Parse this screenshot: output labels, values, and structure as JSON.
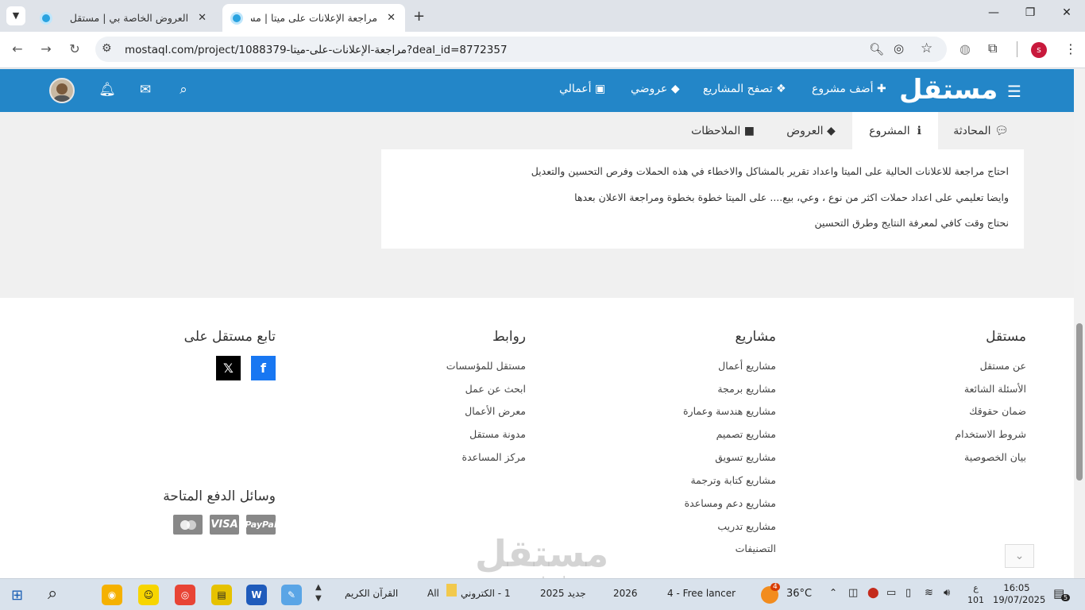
{
  "browser": {
    "tabs": [
      {
        "title": "العروض الخاصة بي | مستقل",
        "active": false
      },
      {
        "title": "مراجعة الإعلانات على ميتا | مستقل",
        "active": true
      }
    ],
    "new_tab": "+",
    "url": "mostaql.com/project/1088379-مراجعة-الإعلانات-على-ميتا?deal_id=8772357",
    "profile_initial": "s"
  },
  "site": {
    "logo": "مستقل",
    "nav": {
      "add_project": "أضف مشروع",
      "browse_projects": "تصفح المشاريع",
      "my_bids": "عروضي",
      "my_works": "أعمالي"
    },
    "project_tabs": {
      "conversation": "المحادثة",
      "project": "المشروع",
      "bids": "العروض",
      "notes": "الملاحظات"
    },
    "description": [
      "احتاج مراجعة للاعلانات الحالية على الميتا واعداد تقرير بالمشاكل والاخطاء في هذه الحملات وفرص التحسين والتعديل",
      "وايضا تعليمي على اعداد حملات اكثر من نوع ، وعي، بيع.... على الميتا خطوة بخطوة ومراجعة الاعلان بعدها",
      "نحتاج وقت كافي لمعرفة النتايج وطرق التحسين"
    ]
  },
  "footer": {
    "mostaql": {
      "heading": "مستقل",
      "links": [
        "عن مستقل",
        "الأسئلة الشائعة",
        "ضمان حقوقك",
        "شروط الاستخدام",
        "بيان الخصوصية"
      ]
    },
    "projects": {
      "heading": "مشاريع",
      "links": [
        "مشاريع أعمال",
        "مشاريع برمجة",
        "مشاريع هندسة وعمارة",
        "مشاريع تصميم",
        "مشاريع تسويق",
        "مشاريع كتابة وترجمة",
        "مشاريع دعم ومساعدة",
        "مشاريع تدريب",
        "التصنيفات"
      ]
    },
    "links": {
      "heading": "روابط",
      "links": [
        "مستقل للمؤسسات",
        "ابحث عن عمل",
        "معرض الأعمال",
        "مدونة مستقل",
        "مركز المساعدة"
      ]
    },
    "follow": {
      "heading": "تابع مستقل على",
      "facebook": "f",
      "x": "𝕏"
    },
    "payment": {
      "heading": "وسائل الدفع المتاحة",
      "methods": [
        "mastercard",
        "VISA",
        "PayPal"
      ]
    },
    "watermark": "مستقل",
    "watermark_url": "mostaql.com"
  },
  "taskbar": {
    "items": [
      "القرآن الكريم",
      "All",
      "1 - الكتروني",
      "جديد 2025",
      "2026",
      "4 - Free lancer"
    ],
    "weather": "36°C",
    "weather_badge": "4",
    "lang_top": "ع",
    "lang_bottom": "101",
    "time": "16:05",
    "date": "19/07/2025",
    "notif_count": "5"
  },
  "colors": {
    "brand": "#2386c8",
    "facebook": "#1877f2"
  }
}
